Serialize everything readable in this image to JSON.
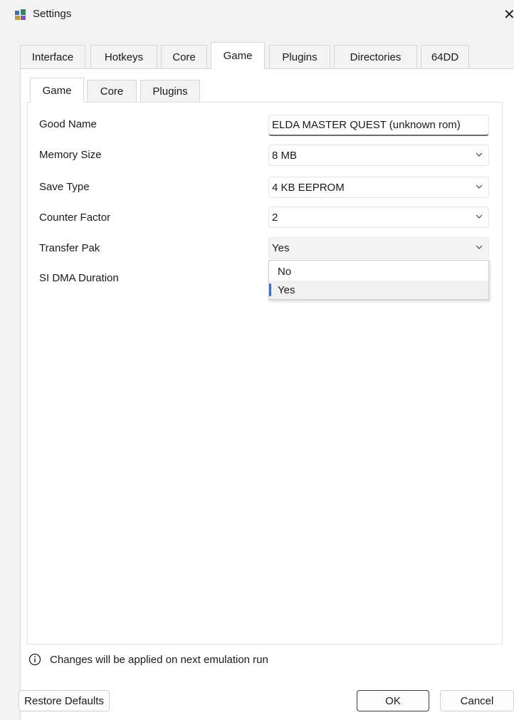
{
  "window": {
    "title": "Settings",
    "close_glyph": "✕"
  },
  "top_tabs": [
    {
      "label": "Interface"
    },
    {
      "label": "Hotkeys"
    },
    {
      "label": "Core"
    },
    {
      "label": "Game",
      "active": true
    },
    {
      "label": "Plugins"
    },
    {
      "label": "Directories"
    },
    {
      "label": "64DD"
    }
  ],
  "sub_tabs": [
    {
      "label": "Game",
      "active": true
    },
    {
      "label": "Core"
    },
    {
      "label": "Plugins"
    }
  ],
  "fields": {
    "good_name": {
      "label": "Good Name",
      "value": "ELDA MASTER QUEST (unknown rom)"
    },
    "memory_size": {
      "label": "Memory Size",
      "value": "8 MB"
    },
    "save_type": {
      "label": "Save Type",
      "value": "4 KB EEPROM"
    },
    "counter_factor": {
      "label": "Counter Factor",
      "value": "2"
    },
    "transfer_pak": {
      "label": "Transfer Pak",
      "value": "Yes",
      "options": [
        "No",
        "Yes"
      ]
    },
    "si_dma_duration": {
      "label": "SI DMA Duration"
    }
  },
  "info": {
    "text": "Changes will be applied on next emulation run"
  },
  "buttons": {
    "restore_defaults": "Restore Defaults",
    "ok": "OK",
    "cancel": "Cancel"
  },
  "icons": {
    "app": "app-settings-icon",
    "info": "info-circle-icon",
    "dropdown": "chevron-down-icon"
  },
  "colors": {
    "accent": "#3a6fb5"
  }
}
